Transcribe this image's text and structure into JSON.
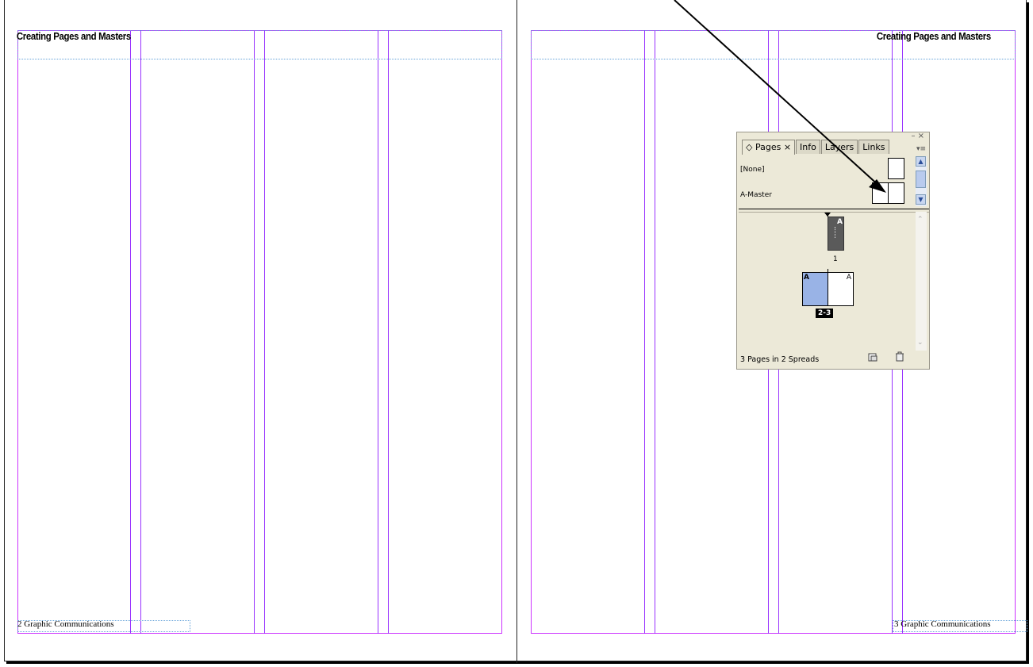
{
  "document": {
    "left_header": "Creating Pages and Masters",
    "right_header": "Creating  Pages and Masters",
    "left_footer": "2 Graphic Communications",
    "right_footer": "3 Graphic Communications"
  },
  "pages_panel": {
    "tabs": [
      {
        "label": "◇ Pages ×",
        "active": true
      },
      {
        "label": "Info",
        "active": false
      },
      {
        "label": "Layers",
        "active": false
      },
      {
        "label": "Links",
        "active": false
      }
    ],
    "window_controls": "– ×",
    "menu_icon": "▾≡",
    "masters": [
      {
        "label": "[None]"
      },
      {
        "label": "A-Master"
      }
    ],
    "page1": {
      "label": "1",
      "prefix": "A"
    },
    "spread2": {
      "label": "2-3",
      "left_prefix": "A",
      "right_prefix": "A"
    },
    "status": "3 Pages in 2 Spreads",
    "icons": [
      "new-page-icon",
      "trash-icon"
    ]
  },
  "colors": {
    "margin": "#cc33ff",
    "column_guide": "#9933ff",
    "frame_edge": "#66a3d9",
    "selected_page": "#99b3e6",
    "page1_thumb": "#5a5a5a"
  }
}
